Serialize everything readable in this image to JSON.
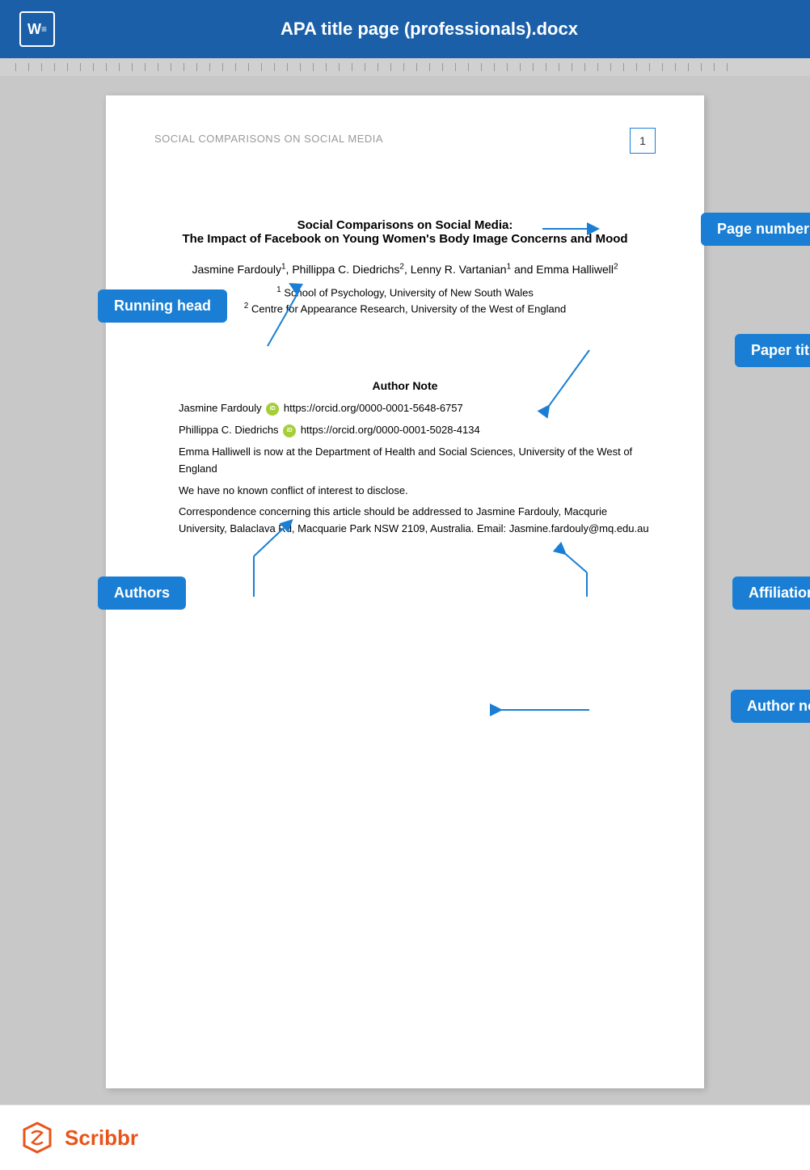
{
  "titleBar": {
    "title": "APA title page (professionals).docx",
    "wordIconLabel": "W≡"
  },
  "document": {
    "runningHead": "SOCIAL COMPARISONS ON SOCIAL MEDIA",
    "pageNumber": "1",
    "paperTitleMain": "Social Comparisons on Social Media:",
    "paperTitleSub": "The Impact of Facebook on Young Women's Body Image Concerns and Mood",
    "authors": "Jasmine Fardouly",
    "authorsRest": ", Phillippa C. Diedrichs",
    "authorsSup2a": "2",
    "authorsMore": ", Lenny R. Vartanian",
    "authorsSup1b": "1",
    "authorsEnd": " and Emma Halliwell",
    "authorsSup2b": "2",
    "affil1": "School of Psychology, University of New South Wales",
    "affil2": "Centre for Appearance Research, University of the West of England",
    "authorNoteTitle": "Author Note",
    "orcidLine1Name": "Jasmine Fardouly",
    "orcidLine1Url": "https://orcid.org/0000-0001-5648-6757",
    "orcidLine2Name": "Phillippa C. Diedrichs",
    "orcidLine2Url": "https://orcid.org/0000-0001-5028-4134",
    "authorNotePara3": "Emma Halliwell is now at the Department of Health and Social Sciences, University of the West of England",
    "authorNotePara4": "We have no known conflict of interest to disclose.",
    "authorNotePara5": "Correspondence concerning this article should be addressed to Jasmine Fardouly, Macqurie University, Balaclava Rd, Macquarie Park NSW 2109, Australia. Email: Jasmine.fardouly@mq.edu.au"
  },
  "annotations": {
    "runningHead": "Running head",
    "pageNumber": "Page number",
    "paperTitle": "Paper title",
    "authors": "Authors",
    "affiliations": "Affiliations",
    "authorNote": "Author note"
  },
  "footer": {
    "brandName": "Scribbr"
  }
}
